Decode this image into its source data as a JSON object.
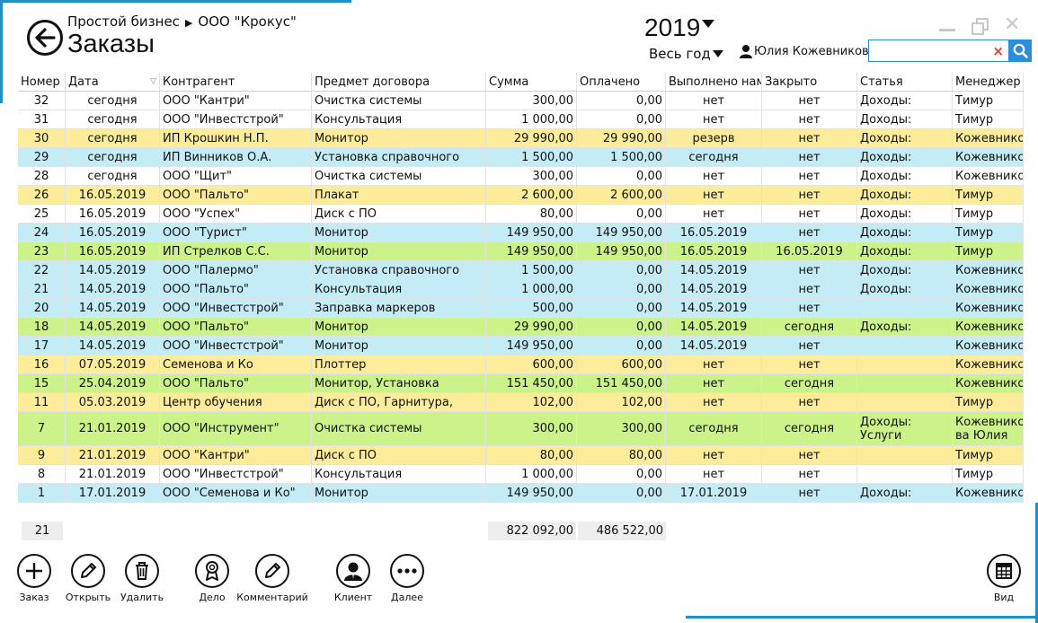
{
  "header": {
    "breadcrumb_root": "Простой бизнес",
    "breadcrumb_org": "ООО \"Крокус\"",
    "title": "Заказы",
    "year": "2019",
    "period": "Весь год",
    "user": "Юлия Кожевникова",
    "search_value": "",
    "search_clear": "×"
  },
  "columns": [
    "Номер",
    "Дата",
    "Контрагент",
    "Предмет договора",
    "Сумма",
    "Оплачено",
    "Выполнено нам",
    "Закрыто",
    "Статья",
    "Менеджер"
  ],
  "rows": [
    {
      "bg": "w",
      "num": "32",
      "date": "сегодня",
      "party": "ООО \"Кантри\"",
      "subject": "Очистка системы",
      "sum": "300,00",
      "paid": "0,00",
      "done": "нет",
      "closed": "нет",
      "article": "Доходы:",
      "manager": "Тимур"
    },
    {
      "bg": "w",
      "num": "31",
      "date": "сегодня",
      "party": "ООО \"Инвестстрой\"",
      "subject": "Консультация",
      "sum": "1 000,00",
      "paid": "0,00",
      "done": "нет",
      "closed": "нет",
      "article": "Доходы:",
      "manager": "Тимур"
    },
    {
      "bg": "y",
      "num": "30",
      "date": "сегодня",
      "party": "ИП Крошкин Н.П.",
      "subject": "Монитор",
      "sum": "29 990,00",
      "paid": "29 990,00",
      "done": "резерв",
      "closed": "нет",
      "article": "Доходы:",
      "manager": "Кожевнико"
    },
    {
      "bg": "b",
      "num": "29",
      "date": "сегодня",
      "party": "ИП Винников О.А.",
      "subject": "Установка справочного",
      "sum": "1 500,00",
      "paid": "1 500,00",
      "done": "сегодня",
      "closed": "нет",
      "article": "Доходы:",
      "manager": "Кожевнико"
    },
    {
      "bg": "w",
      "num": "28",
      "date": "сегодня",
      "party": "ООО \"Щит\"",
      "subject": "Очистка системы",
      "sum": "300,00",
      "paid": "0,00",
      "done": "нет",
      "closed": "нет",
      "article": "Доходы:",
      "manager": "Кожевнико"
    },
    {
      "bg": "y",
      "num": "26",
      "date": "16.05.2019",
      "party": "ООО \"Пальто\"",
      "subject": "Плакат",
      "sum": "2 600,00",
      "paid": "2 600,00",
      "done": "нет",
      "closed": "нет",
      "article": "Доходы:",
      "manager": "Тимур"
    },
    {
      "bg": "w",
      "num": "25",
      "date": "16.05.2019",
      "party": "ООО \"Успех\"",
      "subject": "Диск с ПО",
      "sum": "80,00",
      "paid": "0,00",
      "done": "нет",
      "closed": "нет",
      "article": "Доходы:",
      "manager": "Тимур"
    },
    {
      "bg": "b",
      "num": "24",
      "date": "16.05.2019",
      "party": "ООО \"Турист\"",
      "subject": "Монитор",
      "sum": "149 950,00",
      "paid": "149 950,00",
      "done": "16.05.2019",
      "closed": "нет",
      "article": "Доходы:",
      "manager": "Тимур"
    },
    {
      "bg": "g",
      "num": "23",
      "date": "16.05.2019",
      "party": "ИП Стрелков С.С.",
      "subject": "Монитор",
      "sum": "149 950,00",
      "paid": "149 950,00",
      "done": "16.05.2019",
      "closed": "16.05.2019",
      "article": "Доходы:",
      "manager": "Тимур"
    },
    {
      "bg": "b",
      "num": "22",
      "date": "14.05.2019",
      "party": "ООО \"Палермо\"",
      "subject": "Установка справочного",
      "sum": "1 500,00",
      "paid": "0,00",
      "done": "14.05.2019",
      "closed": "нет",
      "article": "Доходы:",
      "manager": "Кожевнико"
    },
    {
      "bg": "b",
      "num": "21",
      "date": "14.05.2019",
      "party": "ООО \"Пальто\"",
      "subject": "Консультация",
      "sum": "1 000,00",
      "paid": "0,00",
      "done": "14.05.2019",
      "closed": "нет",
      "article": "Доходы:",
      "manager": "Кожевнико"
    },
    {
      "bg": "b",
      "num": "20",
      "date": "14.05.2019",
      "party": "ООО \"Инвестстрой\"",
      "subject": "Заправка маркеров",
      "sum": "500,00",
      "paid": "0,00",
      "done": "14.05.2019",
      "closed": "нет",
      "article": "",
      "manager": "Кожевнико"
    },
    {
      "bg": "g",
      "num": "18",
      "date": "14.05.2019",
      "party": "ООО \"Пальто\"",
      "subject": "Монитор",
      "sum": "29 990,00",
      "paid": "0,00",
      "done": "14.05.2019",
      "closed": "сегодня",
      "article": "Доходы:",
      "manager": "Кожевнико"
    },
    {
      "bg": "b",
      "num": "17",
      "date": "14.05.2019",
      "party": "ООО \"Инвестстрой\"",
      "subject": "Монитор",
      "sum": "149 950,00",
      "paid": "0,00",
      "done": "14.05.2019",
      "closed": "нет",
      "article": "",
      "manager": "Кожевнико"
    },
    {
      "bg": "y",
      "num": "16",
      "date": "07.05.2019",
      "party": "Семенова и Ко",
      "subject": "Плоттер",
      "sum": "600,00",
      "paid": "600,00",
      "done": "нет",
      "closed": "нет",
      "article": "",
      "manager": "Кожевнико"
    },
    {
      "bg": "g",
      "num": "15",
      "date": "25.04.2019",
      "party": "ООО \"Пальто\"",
      "subject": "Монитор, Установка",
      "sum": "151 450,00",
      "paid": "151 450,00",
      "done": "нет",
      "closed": "сегодня",
      "article": "",
      "manager": "Кожевнико"
    },
    {
      "bg": "y",
      "num": "11",
      "date": "05.03.2019",
      "party": "Центр обучения",
      "subject": "Диск с ПО, Гарнитура,",
      "sum": "102,00",
      "paid": "102,00",
      "done": "нет",
      "closed": "нет",
      "article": "",
      "manager": "Тимур"
    },
    {
      "bg": "g",
      "tall": true,
      "num": "7",
      "date": "21.01.2019",
      "party": "ООО \"Инструмент\"",
      "subject": "Очистка системы",
      "sum": "300,00",
      "paid": "300,00",
      "done": "сегодня",
      "closed": "сегодня",
      "article": "Доходы: Услуги",
      "manager": "Кожевнико ва Юлия"
    },
    {
      "bg": "y",
      "num": "9",
      "date": "21.01.2019",
      "party": "ООО \"Кантри\"",
      "subject": "Диск с ПО",
      "sum": "80,00",
      "paid": "80,00",
      "done": "нет",
      "closed": "нет",
      "article": "",
      "manager": "Тимур"
    },
    {
      "bg": "w",
      "num": "8",
      "date": "21.01.2019",
      "party": "ООО \"Инвестстрой\"",
      "subject": "Консультация",
      "sum": "1 000,00",
      "paid": "0,00",
      "done": "нет",
      "closed": "нет",
      "article": "",
      "manager": "Тимур"
    },
    {
      "bg": "b",
      "num": "1",
      "date": "17.01.2019",
      "party": "ООО \"Семенова и Ко\"",
      "subject": "Монитор",
      "sum": "149 950,00",
      "paid": "0,00",
      "done": "17.01.2019",
      "closed": "нет",
      "article": "Доходы:",
      "manager": "Кожевнико"
    }
  ],
  "footer": {
    "count": "21",
    "sum_total": "822 092,00",
    "paid_total": "486 522,00"
  },
  "toolbar": {
    "order": "Заказ",
    "open": "Открыть",
    "delete": "Удалить",
    "deal": "Дело",
    "comment": "Комментарий",
    "client": "Клиент",
    "more": "Далее",
    "view": "Вид"
  },
  "colors": {
    "accent": "#1e90c8",
    "row_yellow": "#fdec9a",
    "row_blue": "#c4ecf7",
    "row_green": "#ccf28a"
  }
}
